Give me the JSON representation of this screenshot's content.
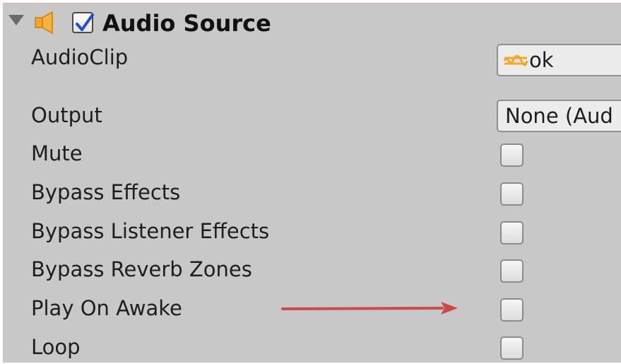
{
  "component": {
    "title": "Audio Source",
    "enabled": true,
    "icon": "speaker-icon",
    "expanded": true
  },
  "fields": {
    "audio_clip": {
      "label": "AudioClip",
      "value": "ok",
      "icon": "audio-clip-icon"
    },
    "output": {
      "label": "Output",
      "value": "None (Aud"
    }
  },
  "toggles": [
    {
      "label": "Mute",
      "checked": false
    },
    {
      "label": "Bypass Effects",
      "checked": false
    },
    {
      "label": "Bypass Listener Effects",
      "checked": false
    },
    {
      "label": "Bypass Reverb Zones",
      "checked": false
    },
    {
      "label": "Play On Awake",
      "checked": false
    },
    {
      "label": "Loop",
      "checked": false
    }
  ],
  "colors": {
    "panel_background": "#c8c8c8",
    "speaker_icon": "#f5a623",
    "annotation_arrow": "#cc4a4a",
    "checkmark": "#1f4fd8"
  }
}
